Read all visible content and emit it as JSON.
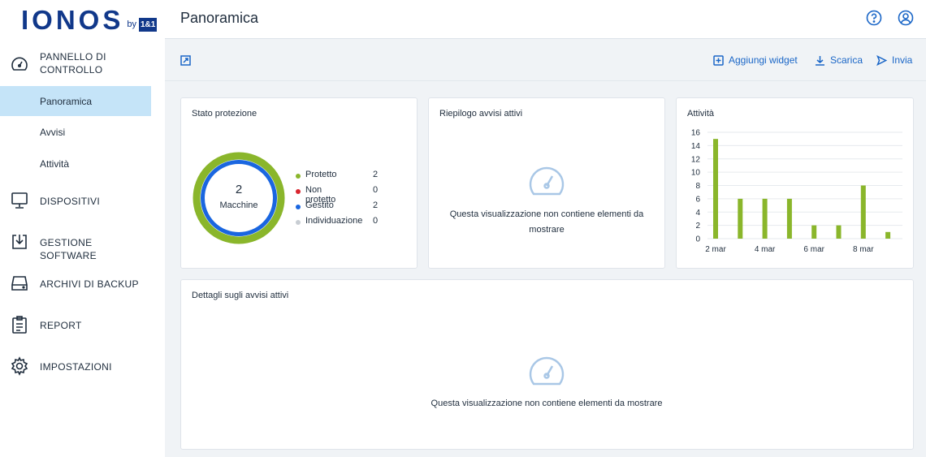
{
  "logo": {
    "main": "IONOS",
    "by": "by",
    "box": "1&1"
  },
  "sidebar": {
    "sections": [
      {
        "label": "PANNELLO DI CONTROLLO",
        "icon": "dashboard-gauge-icon"
      },
      {
        "label": "DISPOSITIVI",
        "icon": "monitor-icon"
      },
      {
        "label": "GESTIONE SOFTWARE",
        "icon": "software-install-icon"
      },
      {
        "label": "ARCHIVI DI BACKUP",
        "icon": "drive-icon"
      },
      {
        "label": "REPORT",
        "icon": "clipboard-icon"
      },
      {
        "label": "IMPOSTAZIONI",
        "icon": "gear-icon"
      }
    ],
    "sub_items": [
      {
        "label": "Panoramica",
        "active": true
      },
      {
        "label": "Avvisi",
        "active": false
      },
      {
        "label": "Attività",
        "active": false
      }
    ]
  },
  "header": {
    "title": "Panoramica",
    "icons": [
      "help-icon",
      "account-icon"
    ]
  },
  "toolbar": {
    "add_widget": "Aggiungi widget",
    "download": "Scarica",
    "send": "Invia"
  },
  "widgets": {
    "protection": {
      "title": "Stato protezione",
      "center_value": "2",
      "center_label": "Macchine",
      "legend": [
        {
          "label": "Protetto",
          "value": "2",
          "color": "#8ab62b"
        },
        {
          "label": "Non protetto",
          "value": "0",
          "color": "#d9262f"
        },
        {
          "label": "Gestito",
          "value": "2",
          "color": "#1a66e0"
        },
        {
          "label": "Individuazione",
          "value": "0",
          "color": "#c8cdd3"
        }
      ]
    },
    "alerts_summary": {
      "title": "Riepilogo avvisi attivi",
      "empty_text": "Questa visualizzazione non contiene elementi da mostrare"
    },
    "activity": {
      "title": "Attività"
    },
    "alert_details": {
      "title": "Dettagli sugli avvisi attivi",
      "empty_text": "Questa visualizzazione non contiene elementi da mostrare"
    }
  },
  "colors": {
    "accent": "#1a66c7",
    "active_bg": "#c5e4f8",
    "bar": "#8ab62b",
    "logo": "#11388a"
  },
  "chart_data": {
    "type": "bar",
    "title": "Attività",
    "x": [
      "2 mar",
      "3 mar",
      "4 mar",
      "5 mar",
      "6 mar",
      "7 mar",
      "8 mar",
      "9 mar"
    ],
    "x_tick_labels": [
      "2 mar",
      "4 mar",
      "6 mar",
      "8 mar"
    ],
    "values": [
      15,
      6,
      6,
      6,
      2,
      2,
      8,
      1
    ],
    "ylim": [
      0,
      16
    ],
    "y_ticks": [
      "0",
      "2",
      "4",
      "6",
      "8",
      "10",
      "12",
      "14",
      "16"
    ],
    "grid": true
  }
}
